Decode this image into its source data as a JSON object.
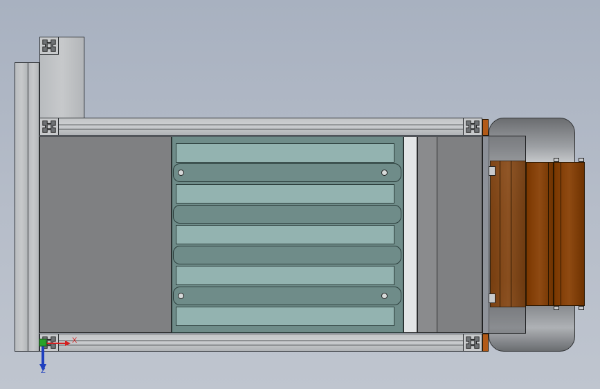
{
  "viewport": {
    "background_top": "#a8b1c0",
    "background_bottom": "#bfc5cf"
  },
  "triad": {
    "x_label": "X",
    "z_label": "Z",
    "x_color": "#d42121",
    "y_color": "#29a329",
    "z_color": "#1f3fbf"
  },
  "colors": {
    "glass_panel": "#93b3b0",
    "copper_coil": "#8f4a12",
    "aluminum_profile": "#c7c9cb",
    "dark_cover": "#7f8082"
  }
}
